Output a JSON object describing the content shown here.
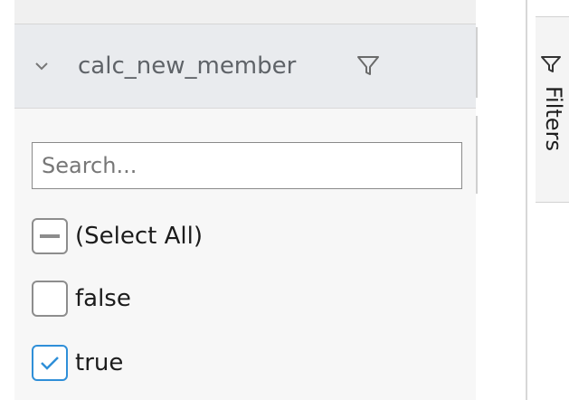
{
  "column_header": {
    "title": "calc_new_member",
    "chevron_icon": "chevron-down-icon",
    "filter_icon": "funnel-icon"
  },
  "search": {
    "placeholder": "Search...",
    "value": ""
  },
  "options": [
    {
      "label": "(Select All)",
      "state": "indeterminate"
    },
    {
      "label": "false",
      "state": "unchecked"
    },
    {
      "label": "true",
      "state": "checked"
    }
  ],
  "side_panel": {
    "filters_label": "Filters",
    "filters_icon": "funnel-icon"
  },
  "colors": {
    "checked_accent": "#2f8fd8",
    "header_bg": "#e9ebee"
  }
}
